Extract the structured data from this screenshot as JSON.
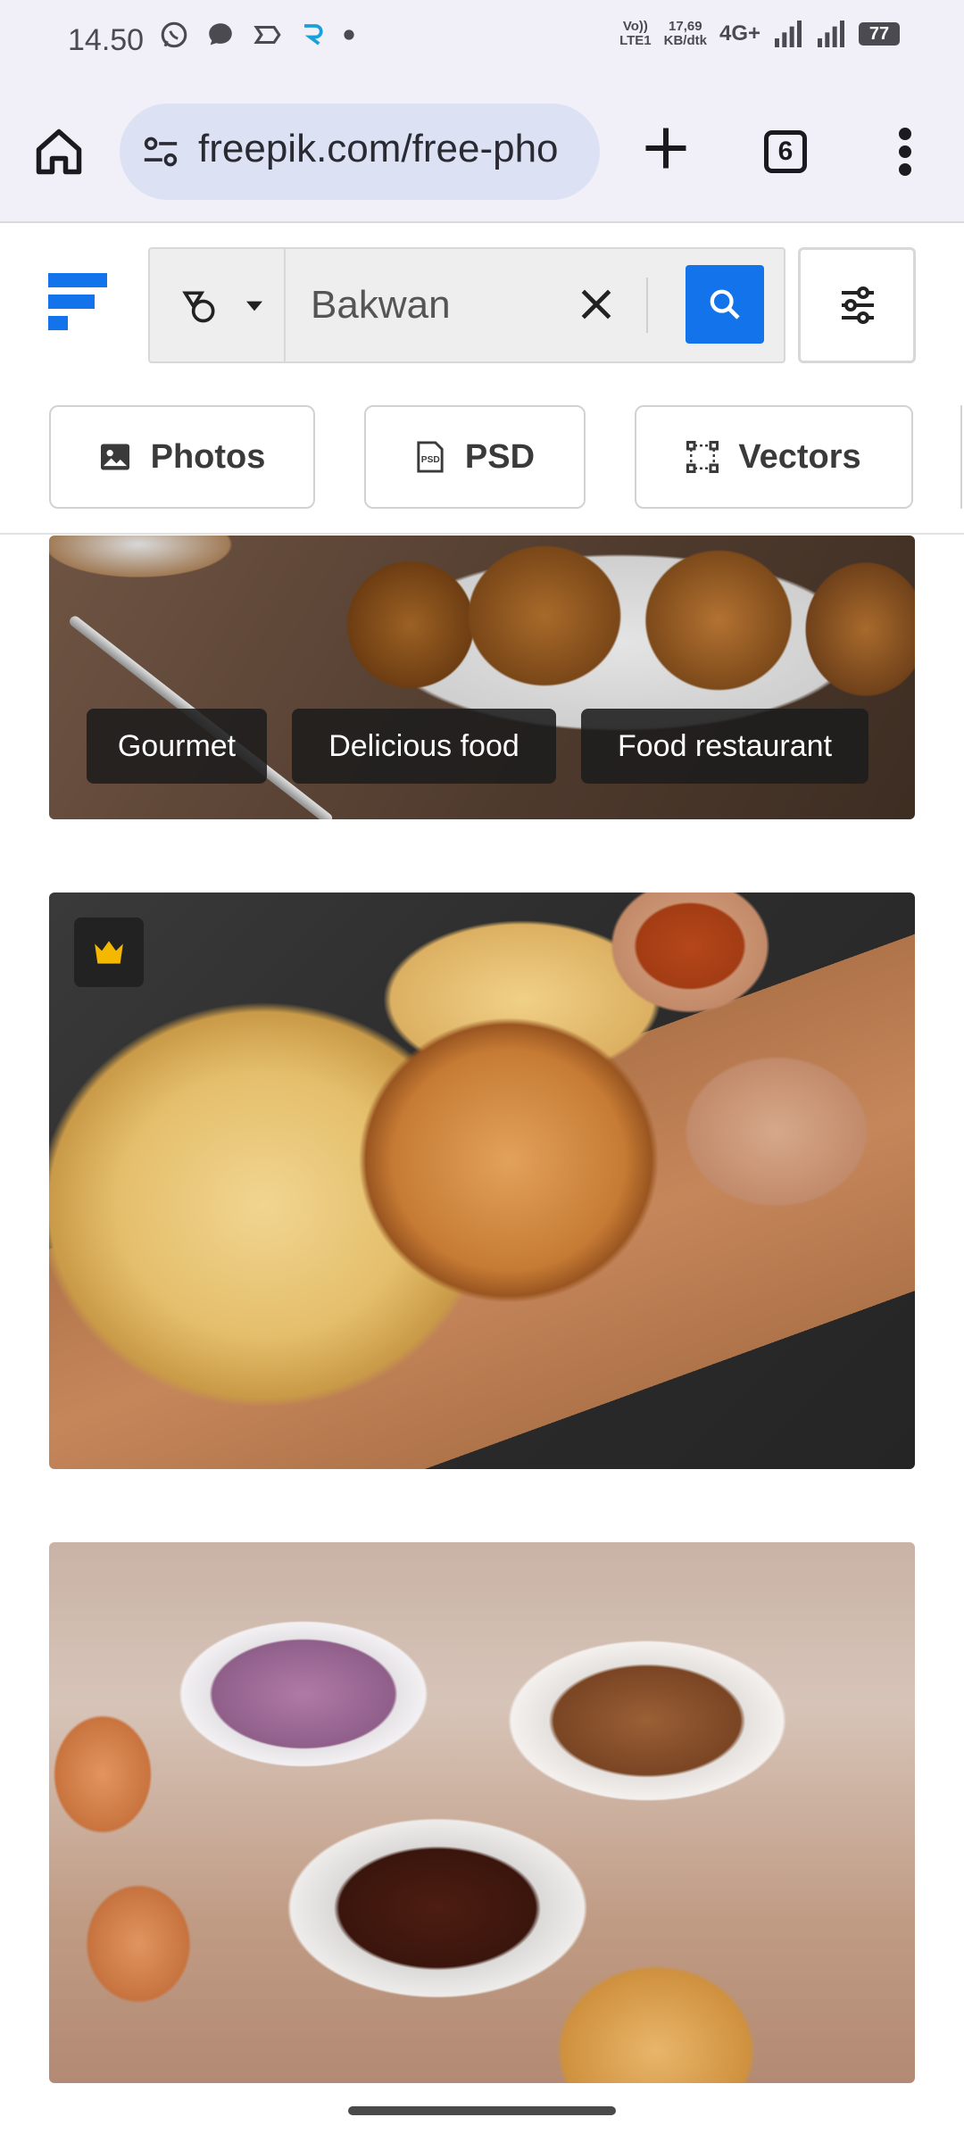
{
  "status_bar": {
    "time": "14.50",
    "volte_line1": "Vo))",
    "volte_line2": "LTE1",
    "speed_line1": "17,69",
    "speed_line2": "KB/dtk",
    "network": "4G+",
    "battery": "77"
  },
  "browser": {
    "url": "freepik.com/free-pho",
    "tab_count": "6"
  },
  "search": {
    "query": "Bakwan"
  },
  "chips": [
    {
      "label": "Photos"
    },
    {
      "label": "PSD"
    },
    {
      "label": "Vectors"
    }
  ],
  "results": {
    "card1_tags": [
      "Gourmet",
      "Delicious food",
      "Food restaurant"
    ]
  },
  "colors": {
    "accent": "#1273eb",
    "logo": "#1273eb",
    "crown": "#f5b800"
  }
}
